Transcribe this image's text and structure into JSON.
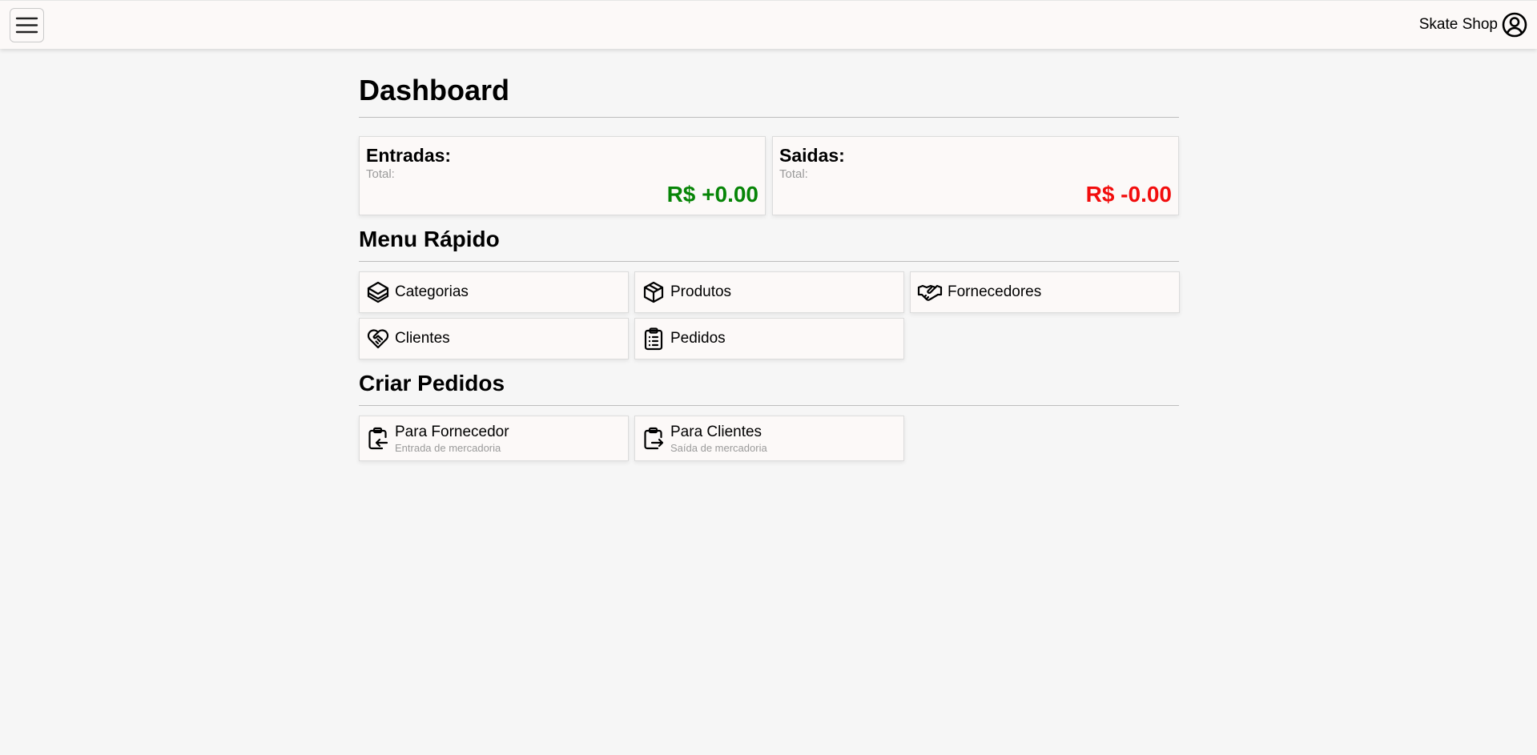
{
  "header": {
    "user_name": "Skate Shop"
  },
  "page": {
    "title": "Dashboard"
  },
  "stats": {
    "entradas": {
      "title": "Entradas:",
      "sub": "Total:",
      "value": "R$ +0.00",
      "color": "#078507"
    },
    "saidas": {
      "title": "Saidas:",
      "sub": "Total:",
      "value": "R$ -0.00",
      "color": "#f20d0d"
    }
  },
  "quick_menu": {
    "title": "Menu Rápido",
    "items": [
      {
        "label": "Categorias",
        "icon": "layers-icon"
      },
      {
        "label": "Produtos",
        "icon": "box-icon"
      },
      {
        "label": "Fornecedores",
        "icon": "handshake-icon"
      },
      {
        "label": "Clientes",
        "icon": "heart-handshake-icon"
      },
      {
        "label": "Pedidos",
        "icon": "clipboard-list-icon"
      }
    ]
  },
  "create_orders": {
    "title": "Criar Pedidos",
    "items": [
      {
        "label": "Para Fornecedor",
        "sub": "Entrada de mercadoria",
        "icon": "clipboard-arrow-in-icon"
      },
      {
        "label": "Para Clientes",
        "sub": "Saída de mercadoria",
        "icon": "clipboard-arrow-out-icon"
      }
    ]
  }
}
